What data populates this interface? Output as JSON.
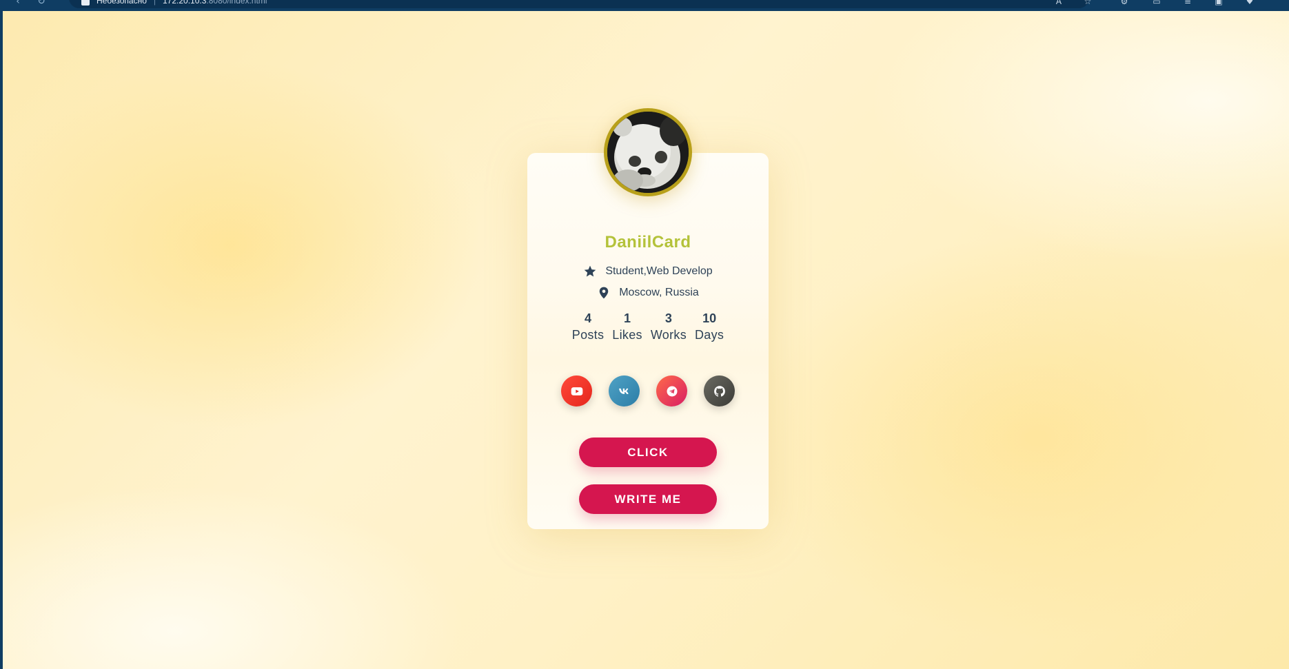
{
  "browser": {
    "site_label": "Небезопасно",
    "url_host": "172.20.10.3",
    "url_rest": ":8080/index.html"
  },
  "card": {
    "name": "DaniilCard",
    "role": "Student,Web Develop",
    "location": "Moscow, Russia",
    "role_icon": "star-icon",
    "location_icon": "map-marker-icon",
    "stats": [
      {
        "value": "4",
        "label": "Posts"
      },
      {
        "value": "1",
        "label": "Likes"
      },
      {
        "value": "3",
        "label": "Works"
      },
      {
        "value": "10",
        "label": "Days"
      }
    ],
    "socials": [
      {
        "name": "youtube",
        "icon": "youtube-icon",
        "color": "#f0302a"
      },
      {
        "name": "vk",
        "icon": "vk-icon",
        "color": "#3a8db5"
      },
      {
        "name": "telegram",
        "icon": "telegram-icon",
        "color": "#e53d5a"
      },
      {
        "name": "github",
        "icon": "github-icon",
        "color": "#4f4f4a"
      }
    ],
    "buttons": {
      "click_label": "CLICK",
      "write_label": "WRITE ME"
    }
  },
  "colors": {
    "accent_name": "#b4c23a",
    "button": "#d5164f",
    "avatar_ring": "#b8a01a",
    "text": "#2e4257"
  }
}
